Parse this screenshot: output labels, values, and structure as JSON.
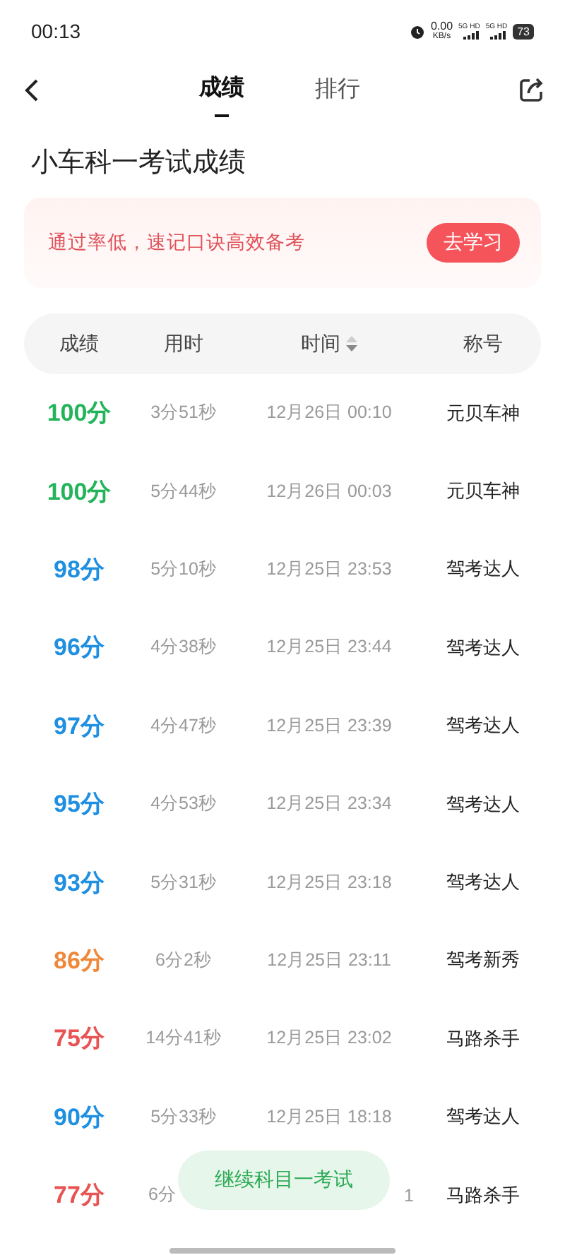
{
  "status_bar": {
    "time": "00:13",
    "speed_value": "0.00",
    "speed_unit": "KB/s",
    "networks": [
      "5G HD",
      "5G HD"
    ],
    "battery": "73"
  },
  "nav": {
    "tabs": [
      {
        "label": "成绩",
        "selected": true
      },
      {
        "label": "排行",
        "selected": false
      }
    ]
  },
  "title": "小车科一考试成绩",
  "banner": {
    "text": "通过率低，速记口诀高效备考",
    "button": "去学习"
  },
  "table": {
    "columns": [
      {
        "label": "成绩",
        "sortable": false
      },
      {
        "label": "用时",
        "sortable": false
      },
      {
        "label": "时间",
        "sortable": true
      },
      {
        "label": "称号",
        "sortable": false
      }
    ],
    "rows": [
      {
        "score": "100分",
        "color": "#23b45a",
        "duration": "3分51秒",
        "time": "12月26日 00:10",
        "rank": "元贝车神"
      },
      {
        "score": "100分",
        "color": "#23b45a",
        "duration": "5分44秒",
        "time": "12月26日 00:03",
        "rank": "元贝车神"
      },
      {
        "score": "98分",
        "color": "#1e8fe1",
        "duration": "5分10秒",
        "time": "12月25日 23:53",
        "rank": "驾考达人"
      },
      {
        "score": "96分",
        "color": "#1e8fe1",
        "duration": "4分38秒",
        "time": "12月25日 23:44",
        "rank": "驾考达人"
      },
      {
        "score": "97分",
        "color": "#1e8fe1",
        "duration": "4分47秒",
        "time": "12月25日 23:39",
        "rank": "驾考达人"
      },
      {
        "score": "95分",
        "color": "#1e8fe1",
        "duration": "4分53秒",
        "time": "12月25日 23:34",
        "rank": "驾考达人"
      },
      {
        "score": "93分",
        "color": "#1e8fe1",
        "duration": "5分31秒",
        "time": "12月25日 23:18",
        "rank": "驾考达人"
      },
      {
        "score": "86分",
        "color": "#f0883a",
        "duration": "6分2秒",
        "time": "12月25日 23:11",
        "rank": "驾考新秀"
      },
      {
        "score": "75分",
        "color": "#e85454",
        "duration": "14分41秒",
        "time": "12月25日 23:02",
        "rank": "马路杀手"
      },
      {
        "score": "90分",
        "color": "#1e8fe1",
        "duration": "5分33秒",
        "time": "12月25日 18:18",
        "rank": "驾考达人"
      },
      {
        "score": "77分",
        "color": "#e85454",
        "duration": "6分",
        "time": "1",
        "rank": "马路杀手"
      }
    ]
  },
  "floating_button": "继续科目一考试"
}
